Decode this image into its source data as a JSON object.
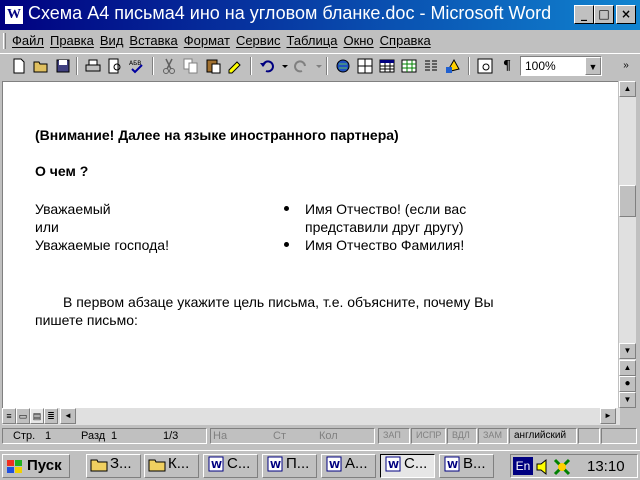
{
  "window": {
    "title": "Схема А4 письма4 ино на угловом бланке.doc - Microsoft Word",
    "app_icon": "W",
    "controls": {
      "minimize": "_",
      "maximize": "□",
      "close": "×"
    }
  },
  "menu": [
    "Файл",
    "Правка",
    "Вид",
    "Вставка",
    "Формат",
    "Сервис",
    "Таблица",
    "Окно",
    "Справка"
  ],
  "toolbar": {
    "icons": [
      "new-icon",
      "open-icon",
      "save-icon",
      "print-icon",
      "print-preview-icon",
      "spelling-icon",
      "cut-icon",
      "copy-icon",
      "paste-icon",
      "format-painter-icon",
      "undo-icon",
      "redo-icon",
      "hyperlink-icon",
      "tables-borders-icon",
      "insert-table-icon",
      "insert-excel-icon",
      "columns-icon",
      "drawing-icon",
      "document-map-icon",
      "show-formatting-icon"
    ],
    "zoom": "100%"
  },
  "document": {
    "heading": "(Внимание! Далее на языке иностранного партнера)",
    "question": "О  чем ?",
    "left_lines": [
      "Уважаемый",
      "или",
      "Уважаемые господа!"
    ],
    "bullets": [
      [
        "Имя Отчество! (если вас",
        "представили друг другу)"
      ],
      [
        "Имя Отчество Фамилия!"
      ]
    ],
    "paragraph": [
      "В первом абзаце укажите цель письма, т.е. объясните, почему Вы",
      "пишете письмо:"
    ]
  },
  "status": {
    "page": "Стр.",
    "page_num": "1",
    "section": "Разд",
    "section_num": "1",
    "pages": "1/3",
    "at": "На",
    "line": "Ст",
    "col": "Кол",
    "rec": "ЗАП",
    "trk": "ИСПР",
    "ext": "ВДЛ",
    "ovr": "ЗАМ",
    "lang": "английский"
  },
  "taskbar": {
    "start": "Пуск",
    "buttons": [
      {
        "label": "З...",
        "type": "folder"
      },
      {
        "label": "К...",
        "type": "folder"
      },
      {
        "label": "С...",
        "type": "word"
      },
      {
        "label": "П...",
        "type": "word"
      },
      {
        "label": "А...",
        "type": "word"
      },
      {
        "label": "С...",
        "type": "word",
        "active": true
      },
      {
        "label": "В...",
        "type": "word"
      }
    ],
    "lang": "En",
    "time": "13:10"
  }
}
